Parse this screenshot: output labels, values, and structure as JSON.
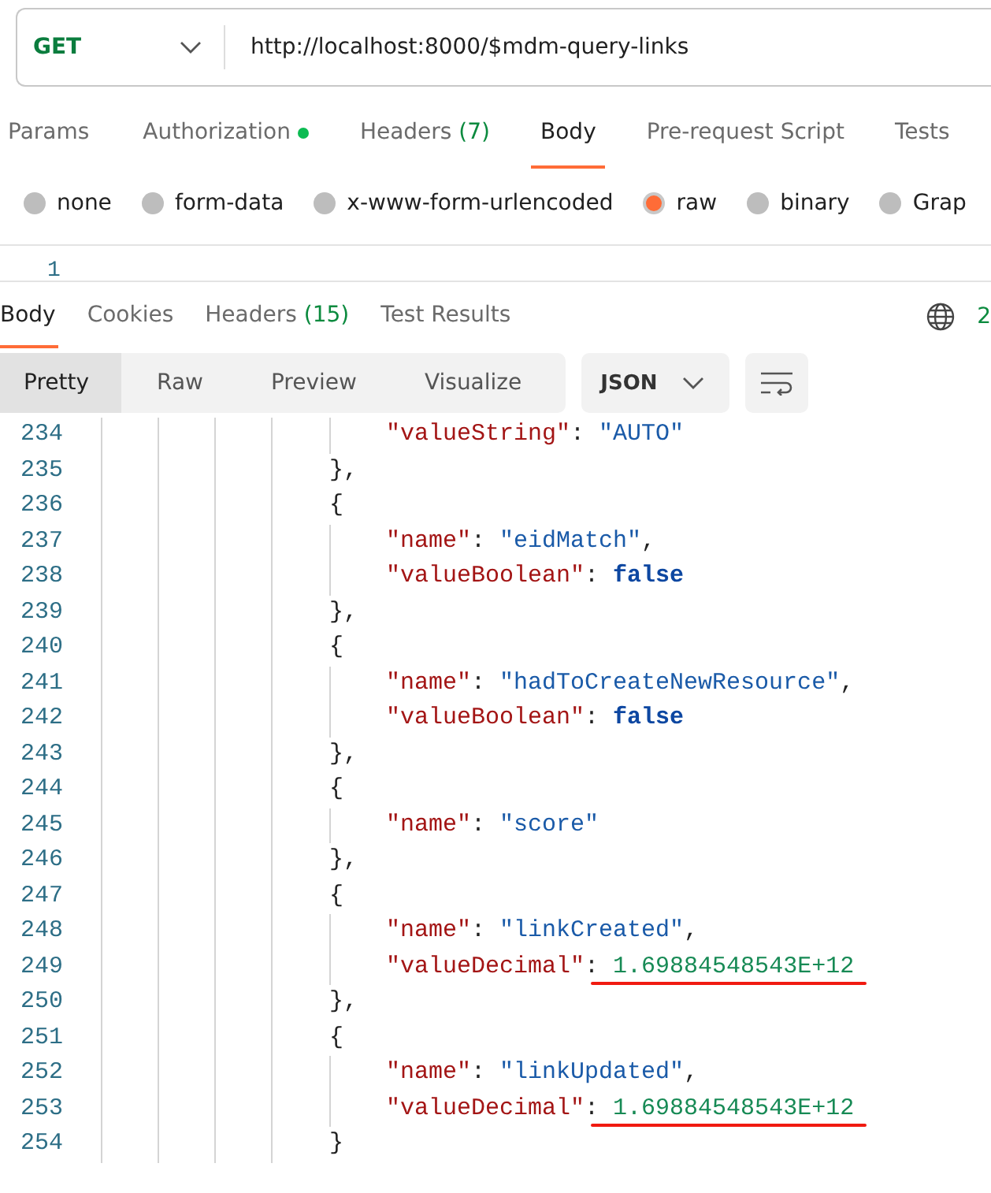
{
  "request": {
    "method": "GET",
    "url": "http://localhost:8000/$mdm-query-links"
  },
  "request_tabs": [
    {
      "label": "Params",
      "dot": false,
      "selected": false
    },
    {
      "label": "Authorization",
      "dot": true,
      "selected": false
    },
    {
      "label": "Headers",
      "count": "(7)",
      "dot": false,
      "selected": false
    },
    {
      "label": "Body",
      "dot": false,
      "selected": true
    },
    {
      "label": "Pre-request Script",
      "dot": false,
      "selected": false
    },
    {
      "label": "Tests",
      "dot": false,
      "selected": false
    }
  ],
  "body_types": [
    {
      "label": "none",
      "selected": false
    },
    {
      "label": "form-data",
      "selected": false
    },
    {
      "label": "x-www-form-urlencoded",
      "selected": false
    },
    {
      "label": "raw",
      "selected": true
    },
    {
      "label": "binary",
      "selected": false
    },
    {
      "label": "Grap",
      "selected": false
    }
  ],
  "request_editor": {
    "line_numbers": [
      "1"
    ]
  },
  "response_tabs": [
    {
      "label": "Body",
      "selected": true
    },
    {
      "label": "Cookies",
      "selected": false
    },
    {
      "label": "Headers",
      "count": "(15)",
      "selected": false
    },
    {
      "label": "Test Results",
      "selected": false
    }
  ],
  "response_status": "2",
  "view_modes": [
    {
      "label": "Pretty",
      "selected": true
    },
    {
      "label": "Raw",
      "selected": false
    },
    {
      "label": "Preview",
      "selected": false
    },
    {
      "label": "Visualize",
      "selected": false
    }
  ],
  "format": "JSON",
  "code_lines": [
    {
      "number": "234",
      "kind": "property",
      "highlighted": false,
      "tokens": [
        {
          "kind": "key",
          "text": "\"valueString\""
        },
        {
          "kind": "punct",
          "text": ": "
        },
        {
          "kind": "string",
          "text": "\"AUTO\""
        }
      ]
    },
    {
      "number": "235",
      "kind": "brace",
      "highlighted": false,
      "tokens": [
        {
          "kind": "punct",
          "text": "},"
        }
      ]
    },
    {
      "number": "236",
      "kind": "brace",
      "highlighted": false,
      "tokens": [
        {
          "kind": "punct",
          "text": "{"
        }
      ]
    },
    {
      "number": "237",
      "kind": "property",
      "highlighted": false,
      "tokens": [
        {
          "kind": "key",
          "text": "\"name\""
        },
        {
          "kind": "punct",
          "text": ": "
        },
        {
          "kind": "string",
          "text": "\"eidMatch\""
        },
        {
          "kind": "punct",
          "text": ","
        }
      ]
    },
    {
      "number": "238",
      "kind": "property",
      "highlighted": false,
      "tokens": [
        {
          "kind": "key",
          "text": "\"valueBoolean\""
        },
        {
          "kind": "punct",
          "text": ": "
        },
        {
          "kind": "boolean",
          "text": "false"
        }
      ]
    },
    {
      "number": "239",
      "kind": "brace",
      "highlighted": false,
      "tokens": [
        {
          "kind": "punct",
          "text": "},"
        }
      ]
    },
    {
      "number": "240",
      "kind": "brace",
      "highlighted": false,
      "tokens": [
        {
          "kind": "punct",
          "text": "{"
        }
      ]
    },
    {
      "number": "241",
      "kind": "property",
      "highlighted": false,
      "tokens": [
        {
          "kind": "key",
          "text": "\"name\""
        },
        {
          "kind": "punct",
          "text": ": "
        },
        {
          "kind": "string",
          "text": "\"hadToCreateNewResource\""
        },
        {
          "kind": "punct",
          "text": ","
        }
      ]
    },
    {
      "number": "242",
      "kind": "property",
      "highlighted": false,
      "tokens": [
        {
          "kind": "key",
          "text": "\"valueBoolean\""
        },
        {
          "kind": "punct",
          "text": ": "
        },
        {
          "kind": "boolean",
          "text": "false"
        }
      ]
    },
    {
      "number": "243",
      "kind": "brace",
      "highlighted": false,
      "tokens": [
        {
          "kind": "punct",
          "text": "},"
        }
      ]
    },
    {
      "number": "244",
      "kind": "brace",
      "highlighted": false,
      "tokens": [
        {
          "kind": "punct",
          "text": "{"
        }
      ]
    },
    {
      "number": "245",
      "kind": "property",
      "highlighted": false,
      "tokens": [
        {
          "kind": "key",
          "text": "\"name\""
        },
        {
          "kind": "punct",
          "text": ": "
        },
        {
          "kind": "string",
          "text": "\"score\""
        }
      ]
    },
    {
      "number": "246",
      "kind": "brace",
      "highlighted": false,
      "tokens": [
        {
          "kind": "punct",
          "text": "},"
        }
      ]
    },
    {
      "number": "247",
      "kind": "brace",
      "highlighted": false,
      "tokens": [
        {
          "kind": "punct",
          "text": "{"
        }
      ]
    },
    {
      "number": "248",
      "kind": "property",
      "highlighted": false,
      "tokens": [
        {
          "kind": "key",
          "text": "\"name\""
        },
        {
          "kind": "punct",
          "text": ": "
        },
        {
          "kind": "string",
          "text": "\"linkCreated\""
        },
        {
          "kind": "punct",
          "text": ","
        }
      ]
    },
    {
      "number": "249",
      "kind": "property",
      "highlighted": true,
      "tokens": [
        {
          "kind": "key",
          "text": "\"valueDecimal\""
        },
        {
          "kind": "punct",
          "text": ": "
        },
        {
          "kind": "number",
          "text": "1.69884548543E+12"
        }
      ]
    },
    {
      "number": "250",
      "kind": "brace",
      "highlighted": false,
      "tokens": [
        {
          "kind": "punct",
          "text": "},"
        }
      ]
    },
    {
      "number": "251",
      "kind": "brace",
      "highlighted": false,
      "tokens": [
        {
          "kind": "punct",
          "text": "{"
        }
      ]
    },
    {
      "number": "252",
      "kind": "property",
      "highlighted": false,
      "tokens": [
        {
          "kind": "key",
          "text": "\"name\""
        },
        {
          "kind": "punct",
          "text": ": "
        },
        {
          "kind": "string",
          "text": "\"linkUpdated\""
        },
        {
          "kind": "punct",
          "text": ","
        }
      ]
    },
    {
      "number": "253",
      "kind": "property",
      "highlighted": true,
      "tokens": [
        {
          "kind": "key",
          "text": "\"valueDecimal\""
        },
        {
          "kind": "punct",
          "text": ": "
        },
        {
          "kind": "number",
          "text": "1.69884548543E+12"
        }
      ]
    },
    {
      "number": "254",
      "kind": "brace",
      "highlighted": false,
      "tokens": [
        {
          "kind": "punct",
          "text": "}"
        }
      ]
    }
  ]
}
